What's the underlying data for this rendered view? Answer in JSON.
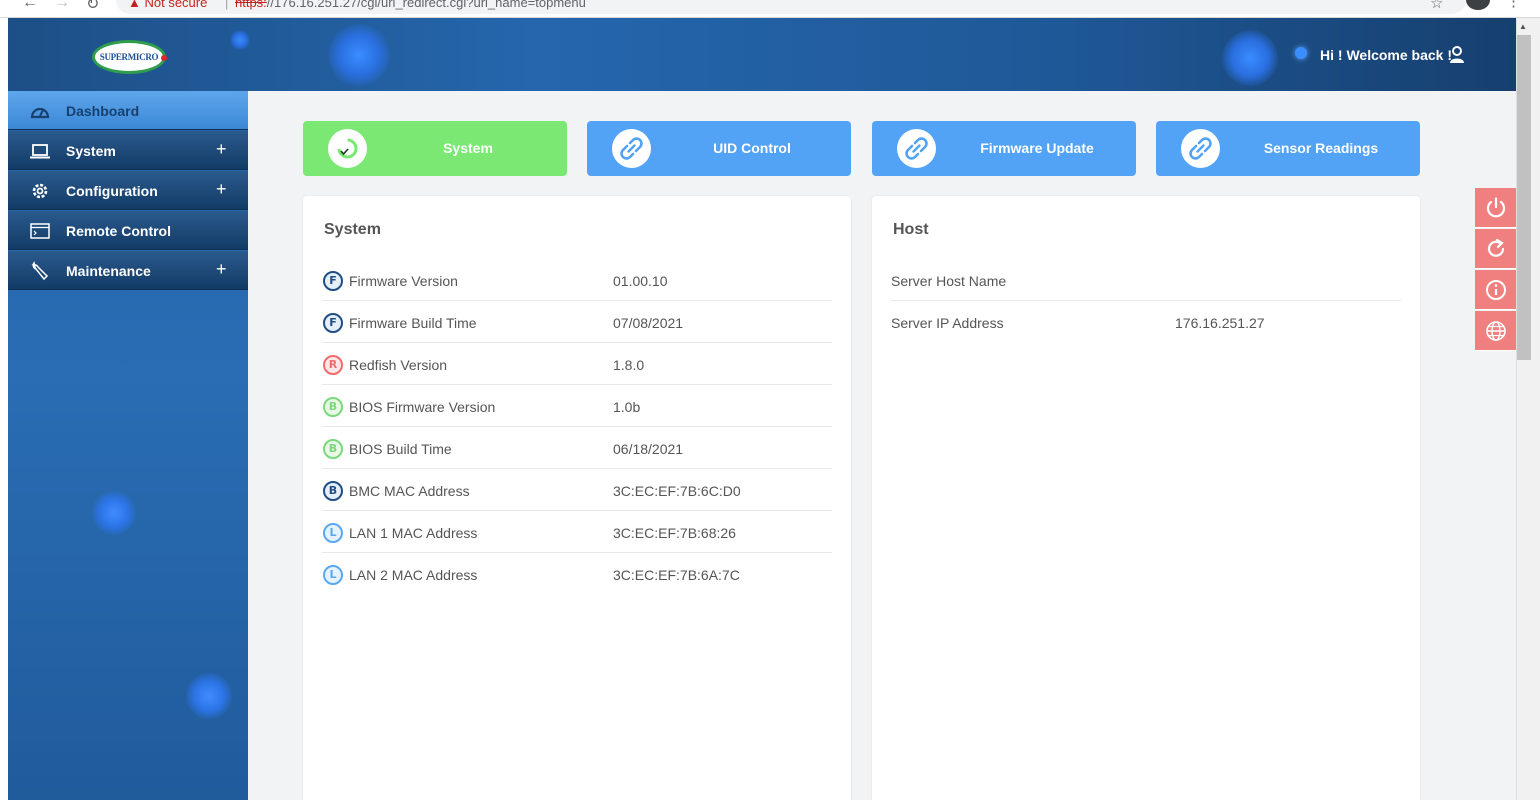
{
  "browser": {
    "security_label": "Not secure",
    "url_scheme": "https:",
    "url_rest": "//176.16.251.27/cgi/url_redirect.cgi?url_name=topmenu"
  },
  "header": {
    "logo_text": "SUPERMICRO",
    "welcome": "Hi ! Welcome back !"
  },
  "sidebar": {
    "items": [
      {
        "label": "Dashboard",
        "icon": "gauge-icon",
        "active": true,
        "expandable": false
      },
      {
        "label": "System",
        "icon": "laptop-icon",
        "active": false,
        "expandable": true
      },
      {
        "label": "Configuration",
        "icon": "gear-icon",
        "active": false,
        "expandable": true
      },
      {
        "label": "Remote Control",
        "icon": "console-icon",
        "active": false,
        "expandable": false
      },
      {
        "label": "Maintenance",
        "icon": "wrench-icon",
        "active": false,
        "expandable": true
      }
    ],
    "expand_symbol": "+"
  },
  "tiles": [
    {
      "label": "System",
      "icon": "status-check-icon",
      "color": "#7ae873"
    },
    {
      "label": "UID Control",
      "icon": "link-icon",
      "color": "#52a2f5"
    },
    {
      "label": "Firmware Update",
      "icon": "link-icon",
      "color": "#52a2f5"
    },
    {
      "label": "Sensor Readings",
      "icon": "link-icon",
      "color": "#52a2f5"
    }
  ],
  "system_panel": {
    "title": "System",
    "rows": [
      {
        "badge": "F",
        "label": "Firmware Version",
        "value": "01.00.10"
      },
      {
        "badge": "F",
        "label": "Firmware Build Time",
        "value": "07/08/2021"
      },
      {
        "badge": "R",
        "label": "Redfish Version",
        "value": "1.8.0"
      },
      {
        "badge": "B",
        "label": "BIOS Firmware Version",
        "value": "1.0b"
      },
      {
        "badge": "B",
        "label": "BIOS Build Time",
        "value": "06/18/2021"
      },
      {
        "badge": "B",
        "label": "BMC MAC Address",
        "value": "3C:EC:EF:7B:6C:D0"
      },
      {
        "badge": "L",
        "label": "LAN 1 MAC Address",
        "value": "3C:EC:EF:7B:68:26"
      },
      {
        "badge": "L",
        "label": "LAN 2 MAC Address",
        "value": "3C:EC:EF:7B:6A:7C"
      }
    ]
  },
  "host_panel": {
    "title": "Host",
    "rows": [
      {
        "label": "Server Host Name",
        "value": ""
      },
      {
        "label": "Server IP Address",
        "value": "176.16.251.27"
      }
    ]
  },
  "actions": [
    {
      "icon": "power-icon"
    },
    {
      "icon": "refresh-icon"
    },
    {
      "icon": "info-icon"
    },
    {
      "icon": "globe-icon"
    }
  ],
  "colors": {
    "header": "#2566ad",
    "sidebar": "#2564a8",
    "tile_blue": "#52a2f5",
    "tile_green": "#7ae873",
    "action_red": "#f08080"
  }
}
